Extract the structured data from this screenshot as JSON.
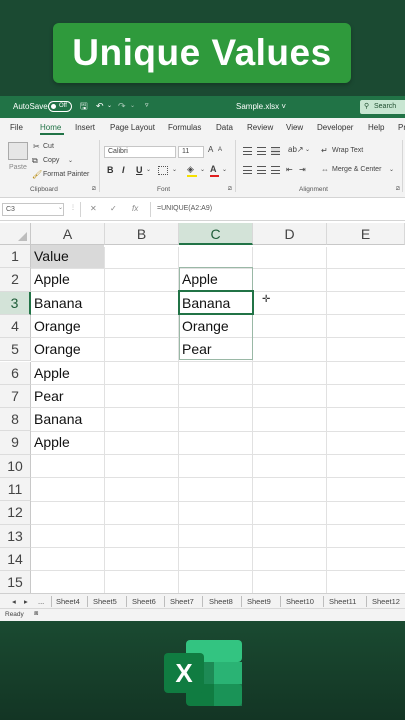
{
  "banner": {
    "title": "Unique Values"
  },
  "titlebar": {
    "autosave_label": "AutoSave",
    "toggle_state": "Off",
    "filename": "Sample.xlsx ˅",
    "search_placeholder": "Search"
  },
  "menu": {
    "items": [
      "File",
      "Home",
      "Insert",
      "Page Layout",
      "Formulas",
      "Data",
      "Review",
      "View",
      "Developer",
      "Help",
      "Pr"
    ],
    "active": "Home"
  },
  "ribbon": {
    "paste": "Paste",
    "cut": "Cut",
    "copy": "Copy",
    "format_painter": "Format Painter",
    "clipboard": "Clipboard",
    "font_name": "Calibri",
    "font_size": "11",
    "bold": "B",
    "italic": "I",
    "underline": "U",
    "font_group": "Font",
    "wrap_text": "Wrap Text",
    "merge_center": "Merge & Center",
    "alignment": "Alignment"
  },
  "formula_bar": {
    "name_box": "C3",
    "cancel": "✕",
    "enter": "✓",
    "fx": "fx",
    "formula": "=UNIQUE(A2:A9)"
  },
  "grid": {
    "columns": [
      "A",
      "B",
      "C",
      "D",
      "E"
    ],
    "selected_column": "C",
    "rows": [
      "1",
      "2",
      "3",
      "4",
      "5",
      "6",
      "7",
      "8",
      "9",
      "10",
      "11",
      "12",
      "13",
      "14",
      "15"
    ],
    "selected_row": "3",
    "column_a": [
      "Value",
      "Apple",
      "Banana",
      "Orange",
      "Orange",
      "Apple",
      "Pear",
      "Banana",
      "Apple"
    ],
    "column_c": [
      "Apple",
      "Banana",
      "Orange",
      "Pear"
    ]
  },
  "sheet_tabs": {
    "nav_prev": "◂",
    "nav_next": "▸",
    "more": "...",
    "tabs": [
      "Sheet4",
      "Sheet5",
      "Sheet6",
      "Sheet7",
      "Sheet8",
      "Sheet9",
      "Sheet10",
      "Sheet11",
      "Sheet12"
    ]
  },
  "status": {
    "text": "Ready"
  },
  "colors": {
    "excel_green": "#217346",
    "banner_green": "#2f9a3c",
    "background": "#17432d"
  },
  "icons": [
    "save-icon",
    "undo-icon",
    "redo-icon",
    "search-icon",
    "scissors-icon",
    "copy-icon",
    "paintbrush-icon",
    "excel-logo-icon"
  ]
}
